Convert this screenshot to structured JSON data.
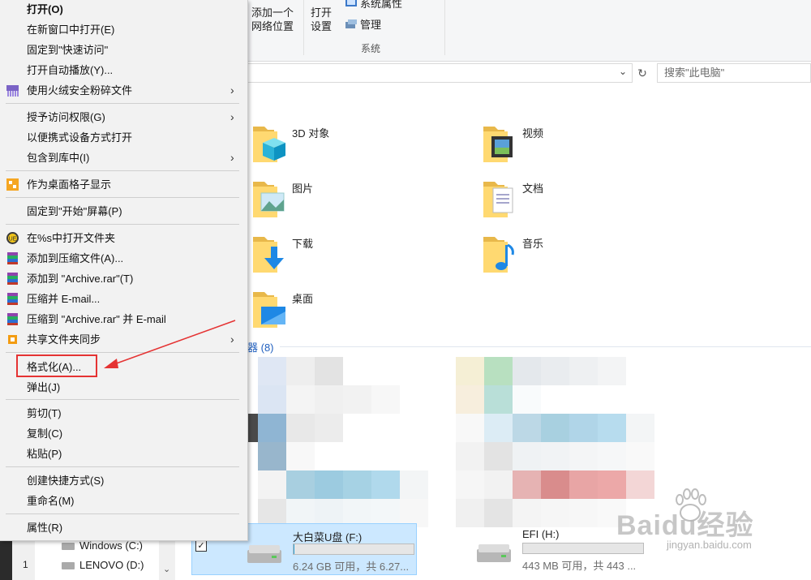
{
  "ribbon": {
    "add_network_line1": "添加一个",
    "add_network_line2": "网络位置",
    "open_settings_line1": "打开",
    "open_settings_line2": "设置",
    "system_properties": "系统属性",
    "manage": "管理",
    "group_system": "系统"
  },
  "address": {
    "search_placeholder": "搜索\"此电脑\"",
    "dropdown_icon": "chevron-down-icon",
    "refresh_icon": "refresh-icon"
  },
  "folders": [
    {
      "label": "3D 对象",
      "icon": "3d-objects-folder-icon"
    },
    {
      "label": "视频",
      "icon": "videos-folder-icon"
    },
    {
      "label": "图片",
      "icon": "pictures-folder-icon"
    },
    {
      "label": "文档",
      "icon": "documents-folder-icon"
    },
    {
      "label": "下载",
      "icon": "downloads-folder-icon"
    },
    {
      "label": "音乐",
      "icon": "music-folder-icon"
    },
    {
      "label": "桌面",
      "icon": "desktop-folder-icon"
    }
  ],
  "devices_section": {
    "label": "器 (8)"
  },
  "drives": [
    {
      "name": "大白菜U盘 (F:)",
      "free": "6.24 GB 可用，共 6.27...",
      "used_fraction": 0.005
    },
    {
      "name": "EFI (H:)",
      "free": "443 MB 可用，共 443 ...",
      "used_fraction": 0.0
    }
  ],
  "navpane": {
    "windows_c": "Windows (C:)",
    "lenovo_d": "LENOVO (D:)",
    "row_num": "1"
  },
  "context_menu": {
    "open": "打开(O)",
    "open_new_window": "在新窗口中打开(E)",
    "pin_quick_access": "固定到\"快速访问\"",
    "open_autoplay": "打开自动播放(Y)...",
    "huorong_shred": "使用火绒安全粉碎文件",
    "give_access": "授予访问权限(G)",
    "open_portable": "以便携式设备方式打开",
    "include_library": "包含到库中(I)",
    "desktop_grid": "作为桌面格子显示",
    "pin_start": "固定到\"开始\"屏幕(P)",
    "open_in_s": "在%s中打开文件夹",
    "add_archive": "添加到压缩文件(A)...",
    "add_archive_rar": "添加到 \"Archive.rar\"(T)",
    "compress_email": "压缩并 E-mail...",
    "compress_rar_email": "压缩到 \"Archive.rar\" 并 E-mail",
    "share_sync": "共享文件夹同步",
    "format": "格式化(A)...",
    "eject": "弹出(J)",
    "cut": "剪切(T)",
    "copy": "复制(C)",
    "paste": "粘贴(P)",
    "create_shortcut": "创建快捷方式(S)",
    "rename": "重命名(M)",
    "properties": "属性(R)"
  },
  "watermark": {
    "brand": "Baidu经验",
    "url": "jingyan.baidu.com"
  },
  "colors": {
    "highlight_red": "#e53333",
    "selection_blue": "#cce8ff",
    "link_blue": "#1f5fbf"
  }
}
